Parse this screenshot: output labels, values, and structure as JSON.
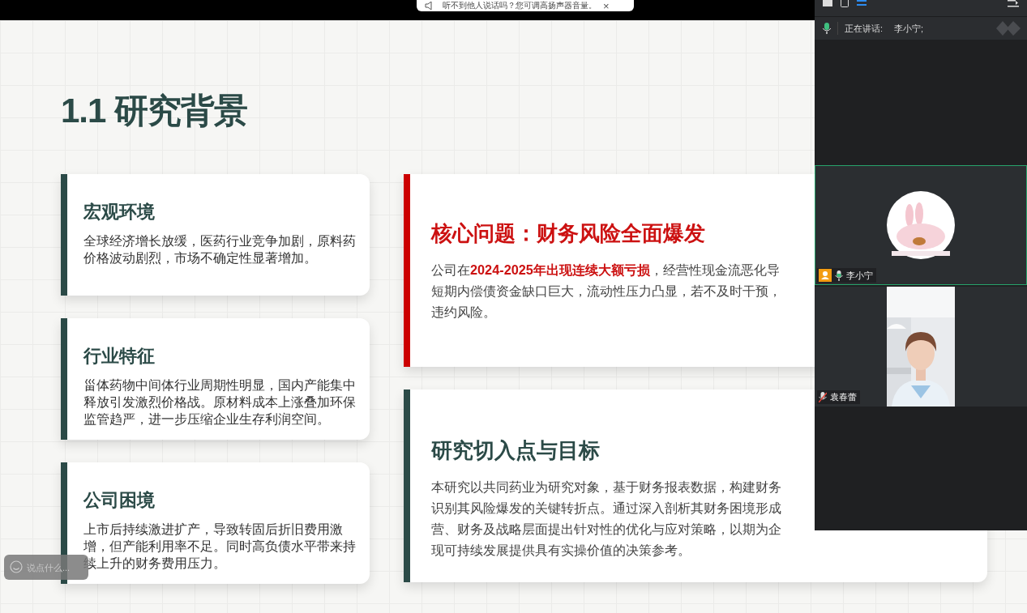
{
  "notification": {
    "text": "听不到他人说话吗？您可调高扬声器音量。",
    "close": "×"
  },
  "slide": {
    "title": "1.1 研究背景",
    "left_cards": [
      {
        "title": "宏观环境",
        "body": "全球经济增长放缓，医药行业竞争加剧，原料药价格波动剧烈，市场不确定性显著增加。"
      },
      {
        "title": "行业特征",
        "body": "甾体药物中间体行业周期性明显，国内产能集中释放引发激烈价格战。原材料成本上涨叠加环保监管趋严，进一步压缩企业生存利润空间。"
      },
      {
        "title": "公司困境",
        "body": "上市后持续激进扩产，导致转固后折旧费用激增，但产能利用率不足。同时高负债水平带来持续上升的财务费用压力。"
      }
    ],
    "right_cards": [
      {
        "kind": "alert",
        "title": "核心问题：财务风险全面爆发",
        "lines": [
          "公司在**2024-2025年出现连续大额亏损**，经营性现金流恶化导",
          "短期内偿债资金缺口巨大，流动性压力凸显，若不及时干预，",
          "违约风险。"
        ]
      },
      {
        "kind": "normal",
        "title": "研究切入点与目标",
        "lines": [
          "本研究以共同药业为研究对象，基于财务报表数据，构建财务",
          "识别其风险爆发的关键转折点。通过深入剖析其财务困境形成",
          "营、财务及战略层面提出针对性的优化与应对策略，以期为企",
          "现可持续发展提供具有实操价值的决策参考。"
        ]
      }
    ]
  },
  "meeting_panel": {
    "speaking_label": "正在讲话:",
    "speaking_name": "李小宁;",
    "participants": [
      {
        "name": "李小宁",
        "kind": "avatar",
        "selected": true,
        "muted": false
      },
      {
        "name": "袁春蕾",
        "kind": "picture",
        "selected": false,
        "muted": true
      }
    ]
  },
  "chat_input": {
    "placeholder": "说点什么..."
  }
}
